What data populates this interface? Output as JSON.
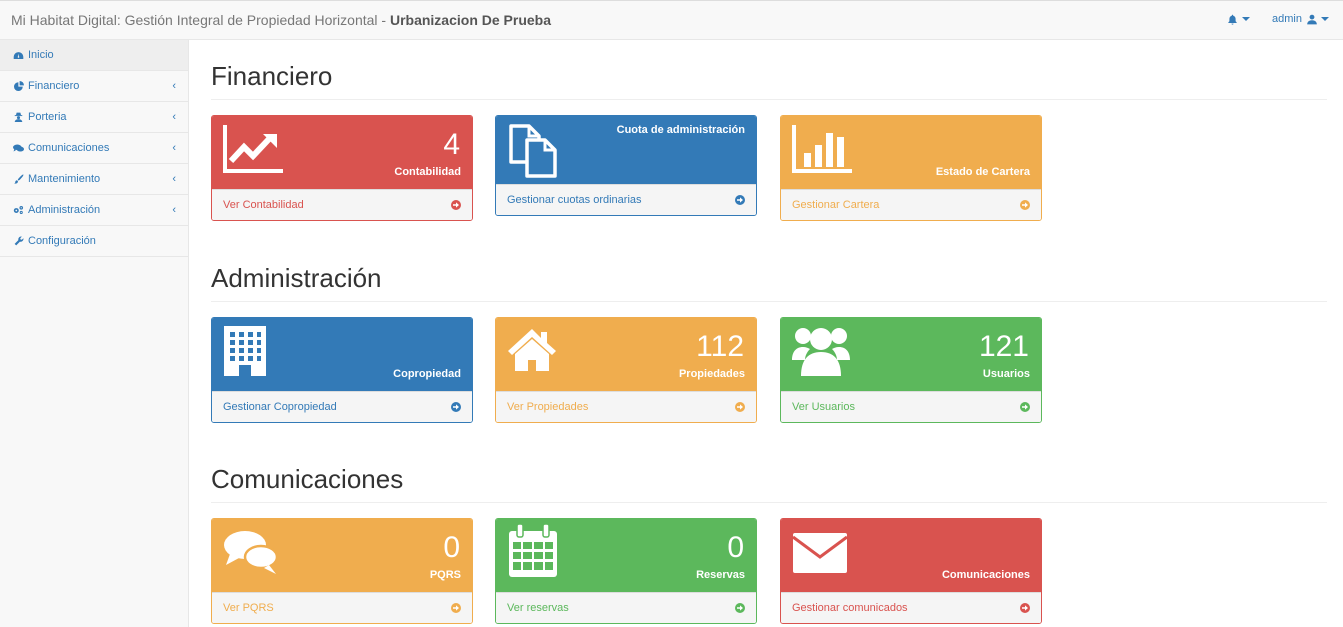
{
  "header": {
    "brand_prefix": "Mi Habitat Digital: Gestión Integral de Propiedad Horizontal - ",
    "brand_name": "Urbanizacion De Prueba",
    "user": "admin"
  },
  "sidebar": {
    "items": [
      {
        "label": "Inicio",
        "icon": "dashboard-icon"
      },
      {
        "label": "Financiero",
        "icon": "pie-chart-icon"
      },
      {
        "label": "Porteria",
        "icon": "user-secret-icon"
      },
      {
        "label": "Comunicaciones",
        "icon": "comments-icon"
      },
      {
        "label": "Mantenimiento",
        "icon": "paint-brush-icon"
      },
      {
        "label": "Administración",
        "icon": "cogs-icon"
      },
      {
        "label": "Configuración",
        "icon": "wrench-icon"
      }
    ]
  },
  "sections": {
    "financiero": {
      "title": "Financiero",
      "contabilidad": {
        "count": "4",
        "label": "Contabilidad",
        "link": "Ver Contabilidad"
      },
      "cuota": {
        "label": "Cuota de administración",
        "link": "Gestionar cuotas ordinarias"
      },
      "cartera": {
        "label": "Estado de Cartera",
        "link": "Gestionar Cartera"
      }
    },
    "administracion": {
      "title": "Administración",
      "copropiedad": {
        "label": "Copropiedad",
        "link": "Gestionar Copropiedad"
      },
      "propiedades": {
        "count": "112",
        "label": "Propiedades",
        "link": "Ver Propiedades"
      },
      "usuarios": {
        "count": "121",
        "label": "Usuarios",
        "link": "Ver Usuarios"
      }
    },
    "comunicaciones": {
      "title": "Comunicaciones",
      "pqrs": {
        "count": "0",
        "label": "PQRS",
        "link": "Ver PQRS"
      },
      "reservas": {
        "count": "0",
        "label": "Reservas",
        "link": "Ver reservas"
      },
      "comunicados": {
        "label": "Comunicaciones",
        "link": "Gestionar comunicados"
      }
    }
  },
  "colors": {
    "primary": "#337ab7",
    "danger": "#d9534f",
    "warning": "#f0ad4e",
    "success": "#5cb85c"
  }
}
